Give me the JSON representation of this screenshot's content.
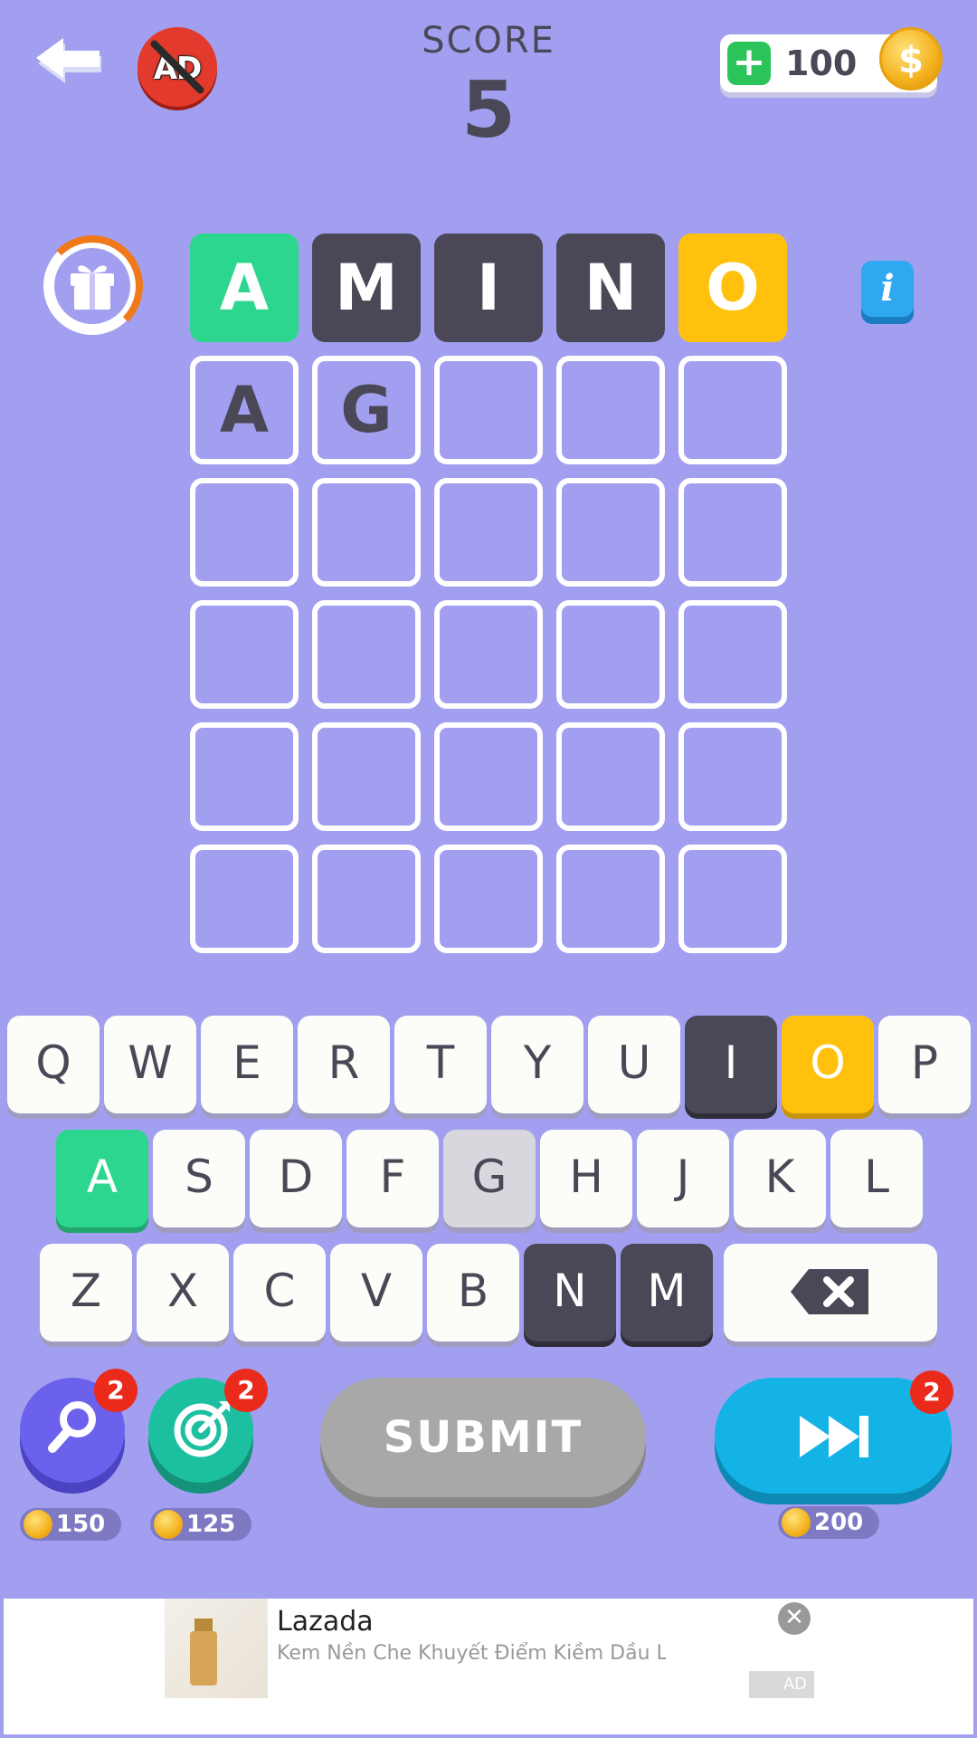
{
  "header": {
    "back_icon": "arrow-left-icon",
    "remove_ads_label": "AD",
    "score_label": "SCORE",
    "score_value": "5",
    "coin_add_icon": "plus-icon",
    "coins": "100",
    "coin_symbol": "$"
  },
  "side": {
    "gift_icon": "gift-icon",
    "info_label": "i"
  },
  "grid": {
    "rows": [
      [
        {
          "letter": "A",
          "state": "green"
        },
        {
          "letter": "M",
          "state": "dark"
        },
        {
          "letter": "I",
          "state": "dark"
        },
        {
          "letter": "N",
          "state": "dark"
        },
        {
          "letter": "O",
          "state": "yellow"
        }
      ],
      [
        {
          "letter": "A",
          "state": "empty"
        },
        {
          "letter": "G",
          "state": "empty"
        },
        {
          "letter": "",
          "state": "empty"
        },
        {
          "letter": "",
          "state": "empty"
        },
        {
          "letter": "",
          "state": "empty"
        }
      ],
      [
        {
          "letter": "",
          "state": "empty"
        },
        {
          "letter": "",
          "state": "empty"
        },
        {
          "letter": "",
          "state": "empty"
        },
        {
          "letter": "",
          "state": "empty"
        },
        {
          "letter": "",
          "state": "empty"
        }
      ],
      [
        {
          "letter": "",
          "state": "empty"
        },
        {
          "letter": "",
          "state": "empty"
        },
        {
          "letter": "",
          "state": "empty"
        },
        {
          "letter": "",
          "state": "empty"
        },
        {
          "letter": "",
          "state": "empty"
        }
      ],
      [
        {
          "letter": "",
          "state": "empty"
        },
        {
          "letter": "",
          "state": "empty"
        },
        {
          "letter": "",
          "state": "empty"
        },
        {
          "letter": "",
          "state": "empty"
        },
        {
          "letter": "",
          "state": "empty"
        }
      ],
      [
        {
          "letter": "",
          "state": "empty"
        },
        {
          "letter": "",
          "state": "empty"
        },
        {
          "letter": "",
          "state": "empty"
        },
        {
          "letter": "",
          "state": "empty"
        },
        {
          "letter": "",
          "state": "empty"
        }
      ]
    ]
  },
  "keyboard": {
    "rows": [
      [
        {
          "k": "Q",
          "s": "normal"
        },
        {
          "k": "W",
          "s": "normal"
        },
        {
          "k": "E",
          "s": "normal"
        },
        {
          "k": "R",
          "s": "normal"
        },
        {
          "k": "T",
          "s": "normal"
        },
        {
          "k": "Y",
          "s": "normal"
        },
        {
          "k": "U",
          "s": "normal"
        },
        {
          "k": "I",
          "s": "dark"
        },
        {
          "k": "O",
          "s": "yellow"
        },
        {
          "k": "P",
          "s": "normal"
        }
      ],
      [
        {
          "k": "A",
          "s": "green"
        },
        {
          "k": "S",
          "s": "normal"
        },
        {
          "k": "D",
          "s": "normal"
        },
        {
          "k": "F",
          "s": "normal"
        },
        {
          "k": "G",
          "s": "gray"
        },
        {
          "k": "H",
          "s": "normal"
        },
        {
          "k": "J",
          "s": "normal"
        },
        {
          "k": "K",
          "s": "normal"
        },
        {
          "k": "L",
          "s": "normal"
        }
      ],
      [
        {
          "k": "Z",
          "s": "normal"
        },
        {
          "k": "X",
          "s": "normal"
        },
        {
          "k": "C",
          "s": "normal"
        },
        {
          "k": "V",
          "s": "normal"
        },
        {
          "k": "B",
          "s": "normal"
        },
        {
          "k": "N",
          "s": "dark"
        },
        {
          "k": "M",
          "s": "dark"
        }
      ]
    ],
    "backspace_icon": "backspace-icon"
  },
  "tools": {
    "hint": {
      "icon": "magnifier-icon",
      "badge": "2",
      "price": "150"
    },
    "target": {
      "icon": "target-icon",
      "badge": "2",
      "price": "125"
    },
    "submit_label": "SUBMIT",
    "skip": {
      "icon": "fast-forward-icon",
      "badge": "2",
      "price": "200"
    }
  },
  "ad": {
    "title": "Lazada",
    "description": "Kem Nền Che Khuyết Điểm Kiềm Dầu Lâu T",
    "close_label": "✕",
    "tag": "AD"
  },
  "colors": {
    "background": "#a39ff0",
    "correct": "#2dd68e",
    "absent": "#4a4857",
    "present": "#ffc10e",
    "submit_disabled": "#a8a8a8",
    "skip": "#13b3e6"
  }
}
